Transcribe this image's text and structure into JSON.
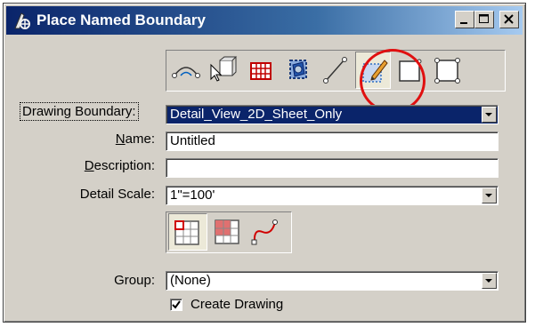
{
  "window": {
    "title": "Place Named Boundary",
    "controls": [
      "minimize",
      "maximize",
      "close"
    ]
  },
  "toolbar_top": {
    "tools": [
      {
        "name": "civil-stationing-icon"
      },
      {
        "name": "from-view-icon"
      },
      {
        "name": "from-2d-sheet-icon"
      },
      {
        "name": "from-3d-view-icon"
      },
      {
        "name": "two-points-icon"
      },
      {
        "name": "shape-icon",
        "selected": true
      },
      {
        "name": "sheet-boundary-icon"
      },
      {
        "name": "rectangle-icon"
      }
    ]
  },
  "form": {
    "drawing_boundary": {
      "label": "Drawing Boundary:",
      "value": "Detail_View_2D_Sheet_Only"
    },
    "name": {
      "label_prefix": "",
      "label_underlined": "N",
      "label_rest": "ame:",
      "value": "Untitled"
    },
    "description": {
      "label_underlined": "D",
      "label_rest": "escription:",
      "value": ""
    },
    "detail_scale": {
      "label": "Detail Scale:",
      "value": "1\"=100'"
    },
    "group": {
      "label": "Group:",
      "value": "(None)"
    },
    "create_drawing": {
      "label": "Create Drawing",
      "checked": true
    }
  },
  "toolbar_bottom": {
    "tools": [
      {
        "name": "clip-single-icon"
      },
      {
        "name": "clip-grid-icon"
      },
      {
        "name": "clip-curve-icon"
      }
    ]
  },
  "colors": {
    "title_start": "#0a246a",
    "title_end": "#a6caf0",
    "selected_bg": "#0a246a",
    "annotation": "#e01010"
  }
}
